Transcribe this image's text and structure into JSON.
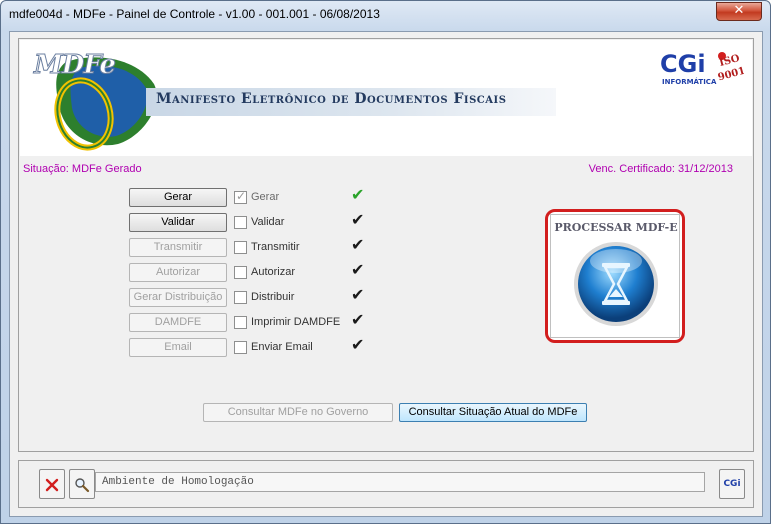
{
  "window": {
    "title": "mdfe004d - MDFe - Painel de Controle - v1.00 - 001.001 - 06/08/2013",
    "close_label": "✕"
  },
  "banner": {
    "logo_text": "MDFe",
    "logo_e": "e",
    "title": "Manifesto Eletrônico de Documentos Fiscais",
    "cgi_text": "CGi",
    "cgi_sub": "INFORMÁTICA",
    "iso_text": "ISO",
    "iso_num": "9001"
  },
  "status": {
    "situacao": "Situação: MDFe Gerado",
    "certificado": "Venc. Certificado: 31/12/2013"
  },
  "steps": [
    {
      "button": "Gerar",
      "check": "Gerar",
      "checked": true,
      "enabled": true,
      "tick_color": "#2aa32a"
    },
    {
      "button": "Validar",
      "check": "Validar",
      "checked": false,
      "enabled": true,
      "tick_color": "#1a1a1a"
    },
    {
      "button": "Transmitir",
      "check": "Transmitir",
      "checked": false,
      "enabled": false,
      "tick_color": "#1a1a1a"
    },
    {
      "button": "Autorizar",
      "check": "Autorizar",
      "checked": false,
      "enabled": false,
      "tick_color": "#1a1a1a"
    },
    {
      "button": "Gerar Distribuição",
      "check": "Distribuir",
      "checked": false,
      "enabled": false,
      "tick_color": "#1a1a1a"
    },
    {
      "button": "DAMDFE",
      "check": "Imprimir DAMDFE",
      "checked": false,
      "enabled": false,
      "tick_color": "#1a1a1a"
    },
    {
      "button": "Email",
      "check": "Enviar Email",
      "checked": false,
      "enabled": false,
      "tick_color": "#1a1a1a"
    }
  ],
  "tick_glyph": "✔",
  "process": {
    "label": "PROCESSAR MDF-E",
    "icon": "hourglass-icon"
  },
  "actions": {
    "consultar_governo": "Consultar MDFe no Governo",
    "consultar_situacao": "Consultar Situação Atual do MDFe"
  },
  "footer": {
    "environment": "Ambiente de Homologação",
    "cgi_button": "CGi"
  },
  "colors": {
    "accent": "#b000b0",
    "highlight_border": "#d21e1e",
    "ok_tick": "#2aa32a"
  }
}
